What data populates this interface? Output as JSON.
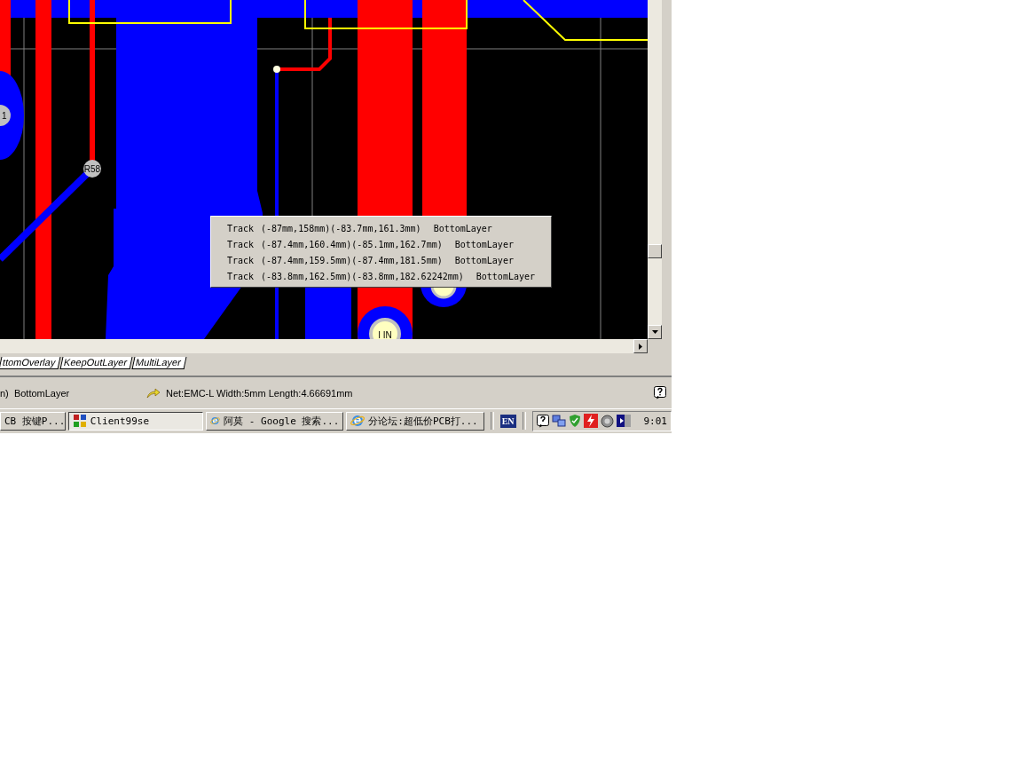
{
  "pcb_view": {
    "pad_labels": [
      "1",
      "R58",
      "I IN"
    ]
  },
  "track_popup": {
    "rows": [
      {
        "type": "Track",
        "coords": "(-87mm,158mm)(-83.7mm,161.3mm)",
        "layer": "BottomLayer"
      },
      {
        "type": "Track",
        "coords": "(-87.4mm,160.4mm)(-85.1mm,162.7mm)",
        "layer": "BottomLayer"
      },
      {
        "type": "Track",
        "coords": "(-87.4mm,159.5mm)(-87.4mm,181.5mm)",
        "layer": "BottomLayer"
      },
      {
        "type": "Track",
        "coords": "(-83.8mm,162.5mm)(-83.8mm,182.62242mm)",
        "layer": "BottomLayer"
      }
    ]
  },
  "layer_tabs": [
    {
      "label": "ttomOverlay"
    },
    {
      "label": "KeepOutLayer"
    },
    {
      "label": "MultiLayer"
    }
  ],
  "status_bar": {
    "layer": "n)  BottomLayer",
    "info": "Net:EMC-L Width:5mm Length:4.66691mm"
  },
  "taskbar": {
    "buttons": [
      {
        "label": "CB  按键P...",
        "kind": "plain",
        "selected": false
      },
      {
        "label": "Client99se",
        "kind": "app",
        "selected": true
      },
      {
        "label": "阿莫 - Google 搜索...",
        "kind": "browser",
        "selected": false
      },
      {
        "label": "分论坛:超低价PCB打...",
        "kind": "browser",
        "selected": false
      }
    ],
    "language": "EN",
    "clock": "9:01"
  }
}
